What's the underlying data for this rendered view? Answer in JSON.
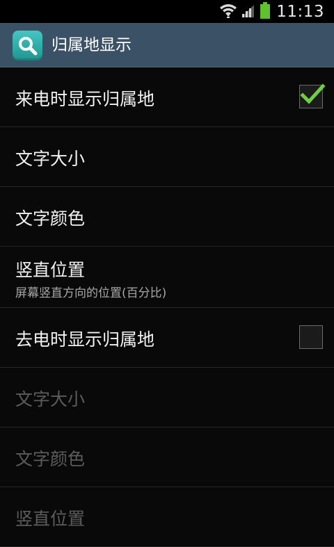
{
  "status_bar": {
    "time": "11:13",
    "icons": [
      "wifi-icon",
      "signal-icon",
      "battery-icon"
    ],
    "battery_color": "#5dc22e"
  },
  "action_bar": {
    "icon": "search-icon",
    "title": "归属地显示",
    "background": "#3b5266"
  },
  "settings": [
    {
      "label": "来电时显示归属地",
      "type": "checkbox",
      "checked": true
    },
    {
      "label": "文字大小",
      "type": "item"
    },
    {
      "label": "文字颜色",
      "type": "item"
    },
    {
      "label": "竖直位置",
      "subtitle": "屏幕竖直方向的位置(百分比)",
      "type": "item"
    },
    {
      "label": "去电时显示归属地",
      "type": "checkbox",
      "checked": false
    },
    {
      "label": "文字大小",
      "type": "item",
      "disabled": true
    },
    {
      "label": "文字颜色",
      "type": "item",
      "disabled": true
    },
    {
      "label": "竖直位置",
      "type": "item",
      "disabled": true
    }
  ],
  "accent_color": "#6fcf3f"
}
